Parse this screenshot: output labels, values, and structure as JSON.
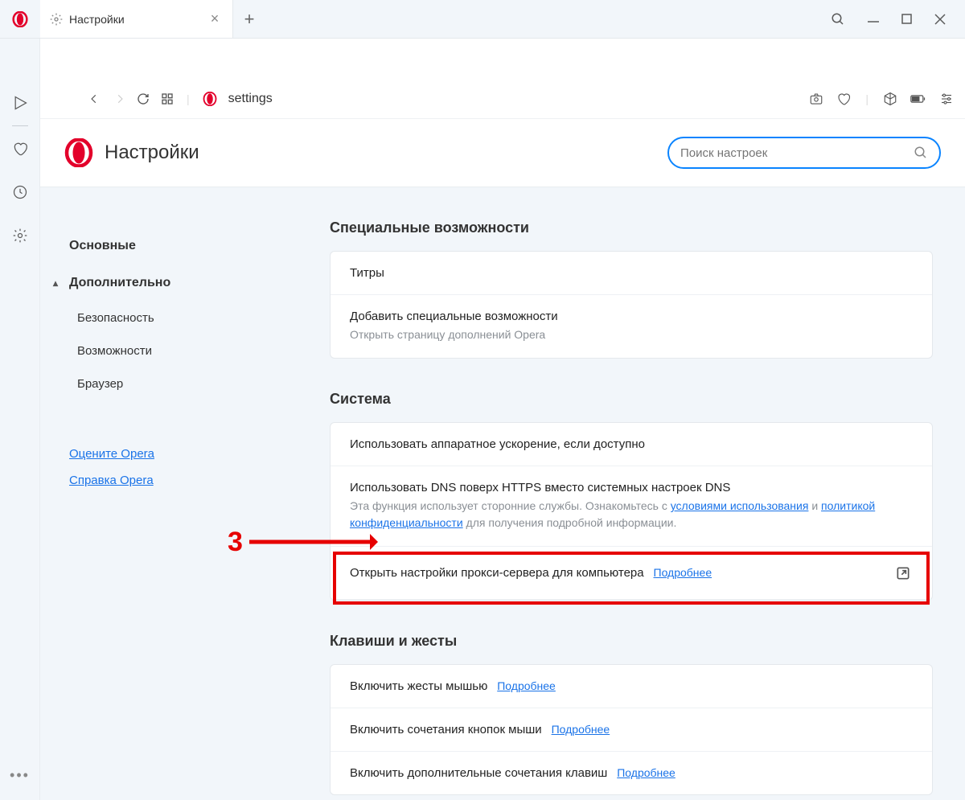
{
  "tab": {
    "title": "Настройки"
  },
  "addressbar": {
    "url": "settings"
  },
  "page": {
    "title": "Настройки",
    "search_placeholder": "Поиск настроек"
  },
  "sidebar": {
    "main": "Основные",
    "advanced": "Дополнительно",
    "sub": [
      "Безопасность",
      "Возможности",
      "Браузер"
    ],
    "links": [
      "Оцените Opera",
      "Справка Opera"
    ]
  },
  "sections": {
    "accessibility": {
      "title": "Специальные возможности",
      "row1": "Титры",
      "row2_title": "Добавить специальные возможности",
      "row2_sub": "Открыть страницу дополнений Opera"
    },
    "system": {
      "title": "Система",
      "row1": "Использовать аппаратное ускорение, если доступно",
      "row2_title": "Использовать DNS поверх HTTPS вместо системных настроек DNS",
      "row2_sub_a": "Эта функция использует сторонние службы. Ознакомьтесь с ",
      "row2_link1": "условиями использования",
      "row2_sub_b": " и ",
      "row2_link2": "политикой конфиденциальности",
      "row2_sub_c": " для получения подробной информации.",
      "row3": "Открыть настройки прокси-сервера для компьютера",
      "row3_link": "Подробнее"
    },
    "shortcuts": {
      "title": "Клавиши и жесты",
      "row1": "Включить жесты мышью",
      "row2": "Включить сочетания кнопок мыши",
      "row3": "Включить дополнительные сочетания клавиш",
      "more": "Подробнее"
    }
  },
  "callout": {
    "num": "3"
  }
}
